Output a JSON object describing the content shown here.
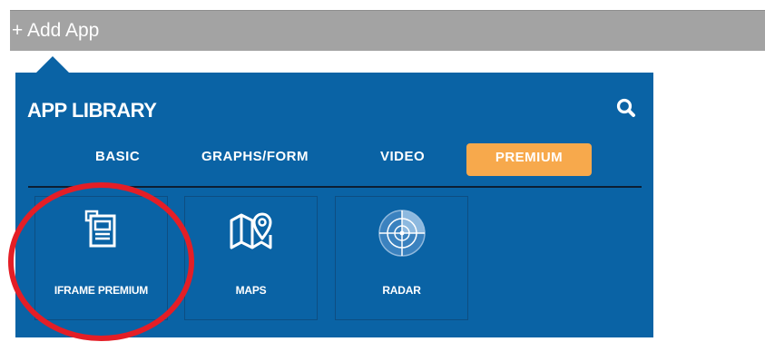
{
  "add_bar": {
    "label": "+ Add App"
  },
  "panel": {
    "title": "APP LIBRARY",
    "search_icon": "search-icon",
    "colors": {
      "panel_bg": "#0a63a5",
      "active_tab_bg": "#f7a94c",
      "annotation": "#e41e26"
    }
  },
  "tabs": [
    {
      "label": "BASIC",
      "active": false
    },
    {
      "label": "GRAPHS/FORM",
      "active": false
    },
    {
      "label": "VIDEO",
      "active": false
    },
    {
      "label": "PREMIUM",
      "active": true
    }
  ],
  "apps": [
    {
      "label": "IFRAME PREMIUM",
      "icon": "iframe-icon"
    },
    {
      "label": "MAPS",
      "icon": "map-pin-icon"
    },
    {
      "label": "RADAR",
      "icon": "radar-icon"
    }
  ]
}
